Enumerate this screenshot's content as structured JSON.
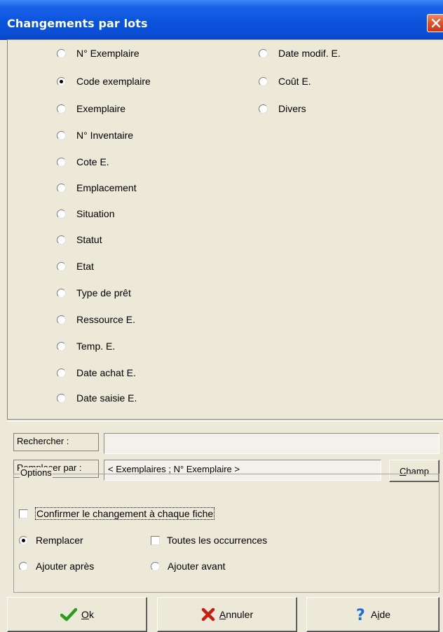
{
  "window": {
    "title": "Changements par lots"
  },
  "fields_group": {
    "left": [
      {
        "label": "N° Exemplaire",
        "checked": false
      },
      {
        "label": "Code exemplaire",
        "checked": true
      },
      {
        "label": "Exemplaire",
        "checked": false
      },
      {
        "label": "N° Inventaire",
        "checked": false
      },
      {
        "label": "Cote E.",
        "checked": false
      },
      {
        "label": "Emplacement",
        "checked": false
      },
      {
        "label": "Situation",
        "checked": false
      },
      {
        "label": "Statut",
        "checked": false
      },
      {
        "label": "Etat",
        "checked": false
      },
      {
        "label": "Type de prêt",
        "checked": false
      },
      {
        "label": "Ressource E.",
        "checked": false
      },
      {
        "label": "Temp. E.",
        "checked": false
      },
      {
        "label": "Date achat E.",
        "checked": false
      },
      {
        "label": "Date saisie E.",
        "checked": false
      }
    ],
    "right": [
      {
        "label": "Date modif. E.",
        "checked": false
      },
      {
        "label": "Coût E.",
        "checked": false
      },
      {
        "label": "Divers",
        "checked": false
      }
    ]
  },
  "search": {
    "label": "Rechercher :",
    "value": ""
  },
  "replace": {
    "label": "Remplacer par :",
    "value": "< Exemplaires ; N° Exemplaire >"
  },
  "champ_button": {
    "mnemonic": "C",
    "rest": "hamp"
  },
  "options": {
    "legend": "Options",
    "confirm_label": "Confirmer le changement à chaque fiche",
    "replace_label": "Remplacer",
    "all_occurrences_label": "Toutes les occurrences",
    "append_after_label": "Ajouter après",
    "append_before_label": "Ajouter avant"
  },
  "buttons": {
    "ok": {
      "mnemonic": "O",
      "rest": "k"
    },
    "cancel": {
      "mnemonic": "A",
      "rest": "nnuler"
    },
    "help": {
      "pre": "A",
      "mnemonic": "i",
      "rest": "de"
    }
  },
  "colors": {
    "titlebar": "#0a53dc",
    "dialog_bg": "#ece9d8",
    "ok_icon": "#2e9a1c",
    "cancel_icon": "#c81e10",
    "help_icon": "#1e6cd8"
  }
}
